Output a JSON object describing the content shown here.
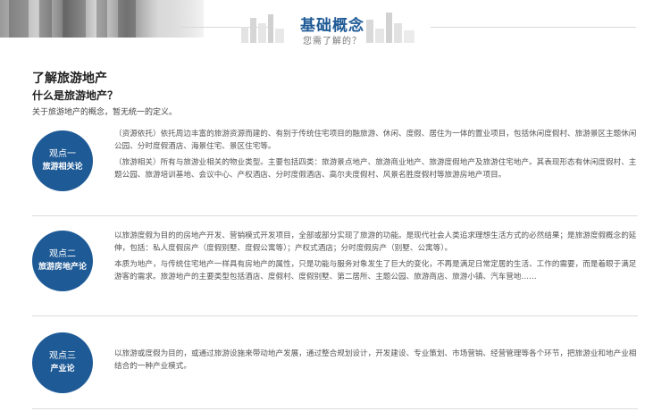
{
  "banner": {
    "title": "基础概念",
    "subtitle": "您需了解的？"
  },
  "intro": {
    "title": "了解旅游地产",
    "subtitle": "什么是旅游地产？",
    "description": "关于旅游地产的概念，暂无统一的定义。"
  },
  "viewpoints": [
    {
      "label": "观点一",
      "topic": "旅游相关论",
      "paragraphs": [
        "（资源依托）依托周边丰富的旅游资源而建的、有别于传统住宅项目的融旅游、休闲、度假、居住为一体的置业项目，包括休闲度假村、旅游景区主题休闲公园、分时度假酒店、海景住宅、景区住宅等。",
        "（旅游相关）所有与旅游业相关的物业类型。主要包括四类：旅游景点地产、旅游商业地产、旅游度假地产及旅游住宅地产。其表现形态有休闲度假村、主题公园、旅游培训基地、会议中心、产权酒店、分时度假酒店、高尔夫度假村、风景名胜度假村等旅游房地产项目。"
      ]
    },
    {
      "label": "观点二",
      "topic": "旅游房地产论",
      "paragraphs": [
        "以旅游度假为目的的房地产开发、营销模式开发项目，全部或部分实现了旅游的功能。是现代社会人类追求理想生活方式的必然结果；是旅游度假概念的延伸，包括：私人度假房产（度假别墅、度假公寓等）；产权式酒店；分时度假房产（别墅、公寓等）。",
        "本质为地产，与传统住宅地产一样具有房地产的属性，只是功能与服务对象发生了巨大的变化，不再是满足日常定居的生活、工作的需要，而是着眼于满足游客的需求。旅游地产的主要类型包括酒店、度假村、度假别墅、第二居所、主题公园、旅游商店、旅游小镇、汽车营地……"
      ]
    },
    {
      "label": "观点三",
      "topic": "产业论",
      "paragraphs": [
        "以旅游或度假为目的，或通过旅游设施来带动地产发展，通过整合规划设计，开发建设、专业策划、市场营销、经营管理等各个环节，把旅游业和地产业相结合的一种产业模式。"
      ]
    }
  ],
  "colors": {
    "accent": "#1e5a96",
    "divider": "#dcdcdc"
  }
}
